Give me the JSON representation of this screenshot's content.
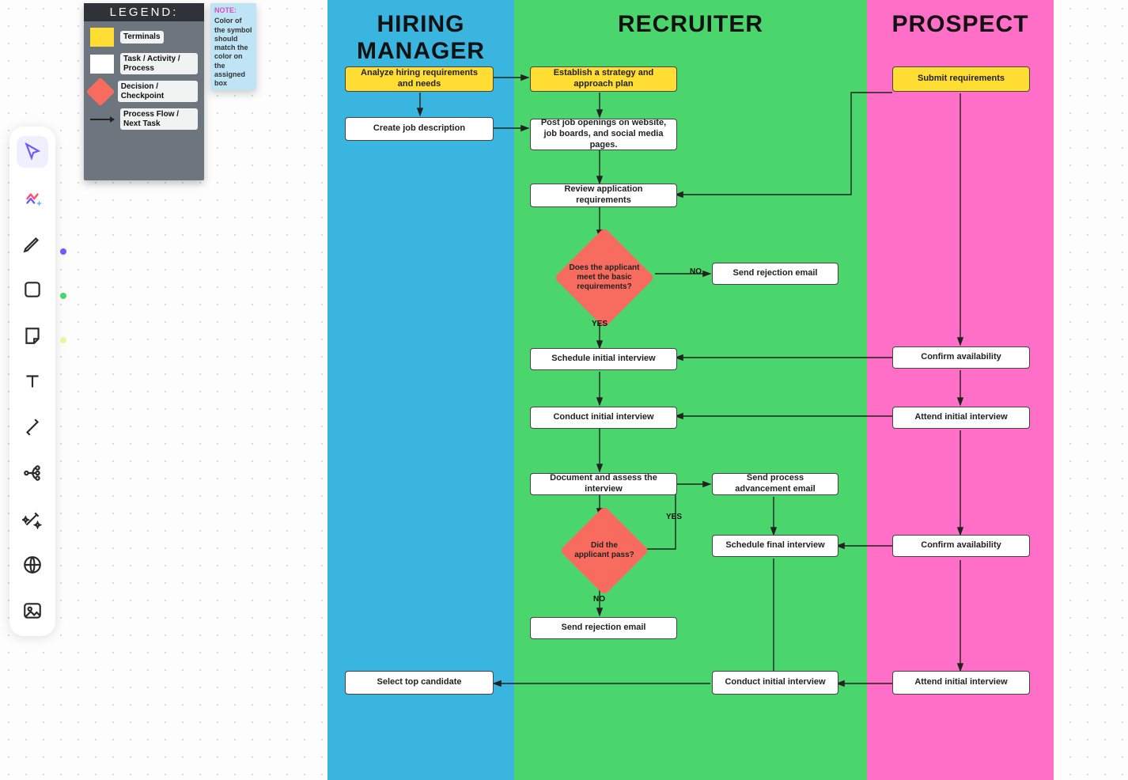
{
  "legend": {
    "title": "LEGEND:",
    "rows": {
      "terminals": "Terminals",
      "task": "Task / Activity / Process",
      "decision": "Decision / Checkpoint",
      "flow": "Process Flow / Next Task"
    }
  },
  "note": {
    "title": "NOTE:",
    "body": "Color of the symbol should match the color on the assigned box"
  },
  "lanes": {
    "hm": "HIRING MANAGER",
    "rec": "RECRUITER",
    "pros": "PROSPECT"
  },
  "colors": {
    "lane_hm": "#39b5e0",
    "lane_rec": "#4ad66d",
    "lane_pros": "#ff6ec7",
    "terminal": "#ffdd33",
    "decision": "#f76c5e"
  },
  "boxes": {
    "hm_analyze": "Analyze hiring requirements and needs",
    "hm_createjd": "Create job description",
    "hm_selecttop": "Select top candidate",
    "rec_strategy": "Establish a strategy and approach plan",
    "rec_post": "Post job openings on website, job boards, and social media pages.",
    "rec_review": "Review application requirements",
    "rec_decide1": "Does the applicant meet the basic requirements?",
    "rec_reject1": "Send rejection email",
    "rec_sched1": "Schedule initial interview",
    "rec_conduct1": "Conduct initial interview",
    "rec_document": "Document and assess the interview",
    "rec_advance": "Send process advancement email",
    "rec_decide2": "Did the applicant pass?",
    "rec_schedfinal": "Schedule final interview",
    "rec_reject2": "Send rejection email",
    "rec_conduct2": "Conduct initial interview",
    "pros_submit": "Submit requirements",
    "pros_confirm1": "Confirm availability",
    "pros_attend1": "Attend initial interview",
    "pros_confirm2": "Confirm availability",
    "pros_attend2": "Attend initial interview"
  },
  "labels": {
    "yes1": "YES",
    "no1": "NO",
    "yes2": "YES",
    "no2": "NO"
  },
  "toolbar": {
    "cursor": "Select",
    "ai": "AI",
    "pen": "Pen",
    "shape": "Shape",
    "sticky": "Sticky note",
    "text": "Text",
    "connector": "Connector",
    "mindmap": "Mind map",
    "magic": "Magic",
    "globe": "Web",
    "image": "Image"
  }
}
